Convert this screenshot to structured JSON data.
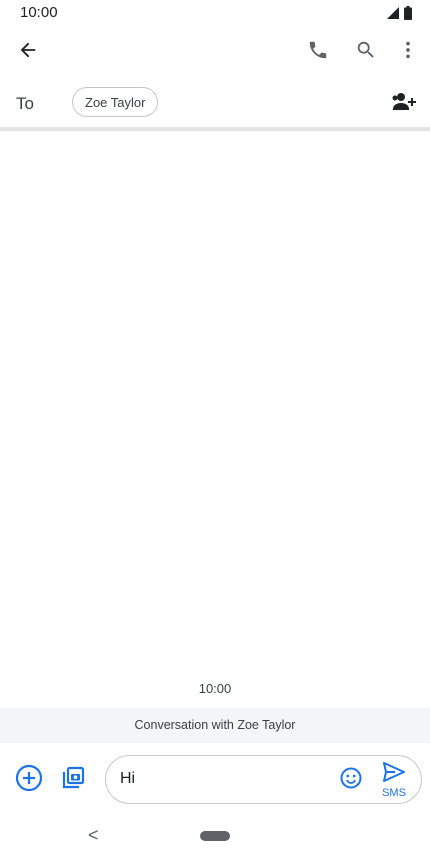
{
  "status_bar": {
    "time": "10:00",
    "icons": [
      "signal-icon",
      "battery-icon"
    ]
  },
  "app_bar": {
    "icons": [
      "back-arrow-icon",
      "phone-icon",
      "search-icon",
      "more-vert-icon"
    ]
  },
  "recipients": {
    "to_label": "To",
    "chips": [
      "Zoe Taylor"
    ],
    "add_icon": "add-contact-icon"
  },
  "conversation": {
    "timestamp": "10:00",
    "banner": "Conversation with Zoe Taylor"
  },
  "compose": {
    "value": "Hi",
    "send_label": "SMS",
    "icons": [
      "add-circle-icon",
      "gallery-icon",
      "emoji-icon",
      "send-icon"
    ]
  },
  "nav_bar": {
    "back_glyph": "<"
  },
  "colors": {
    "accent": "#1a73e8",
    "icon": "#5f6368",
    "banner_bg": "#f3f5f7",
    "divider": "#e3e3e3"
  }
}
